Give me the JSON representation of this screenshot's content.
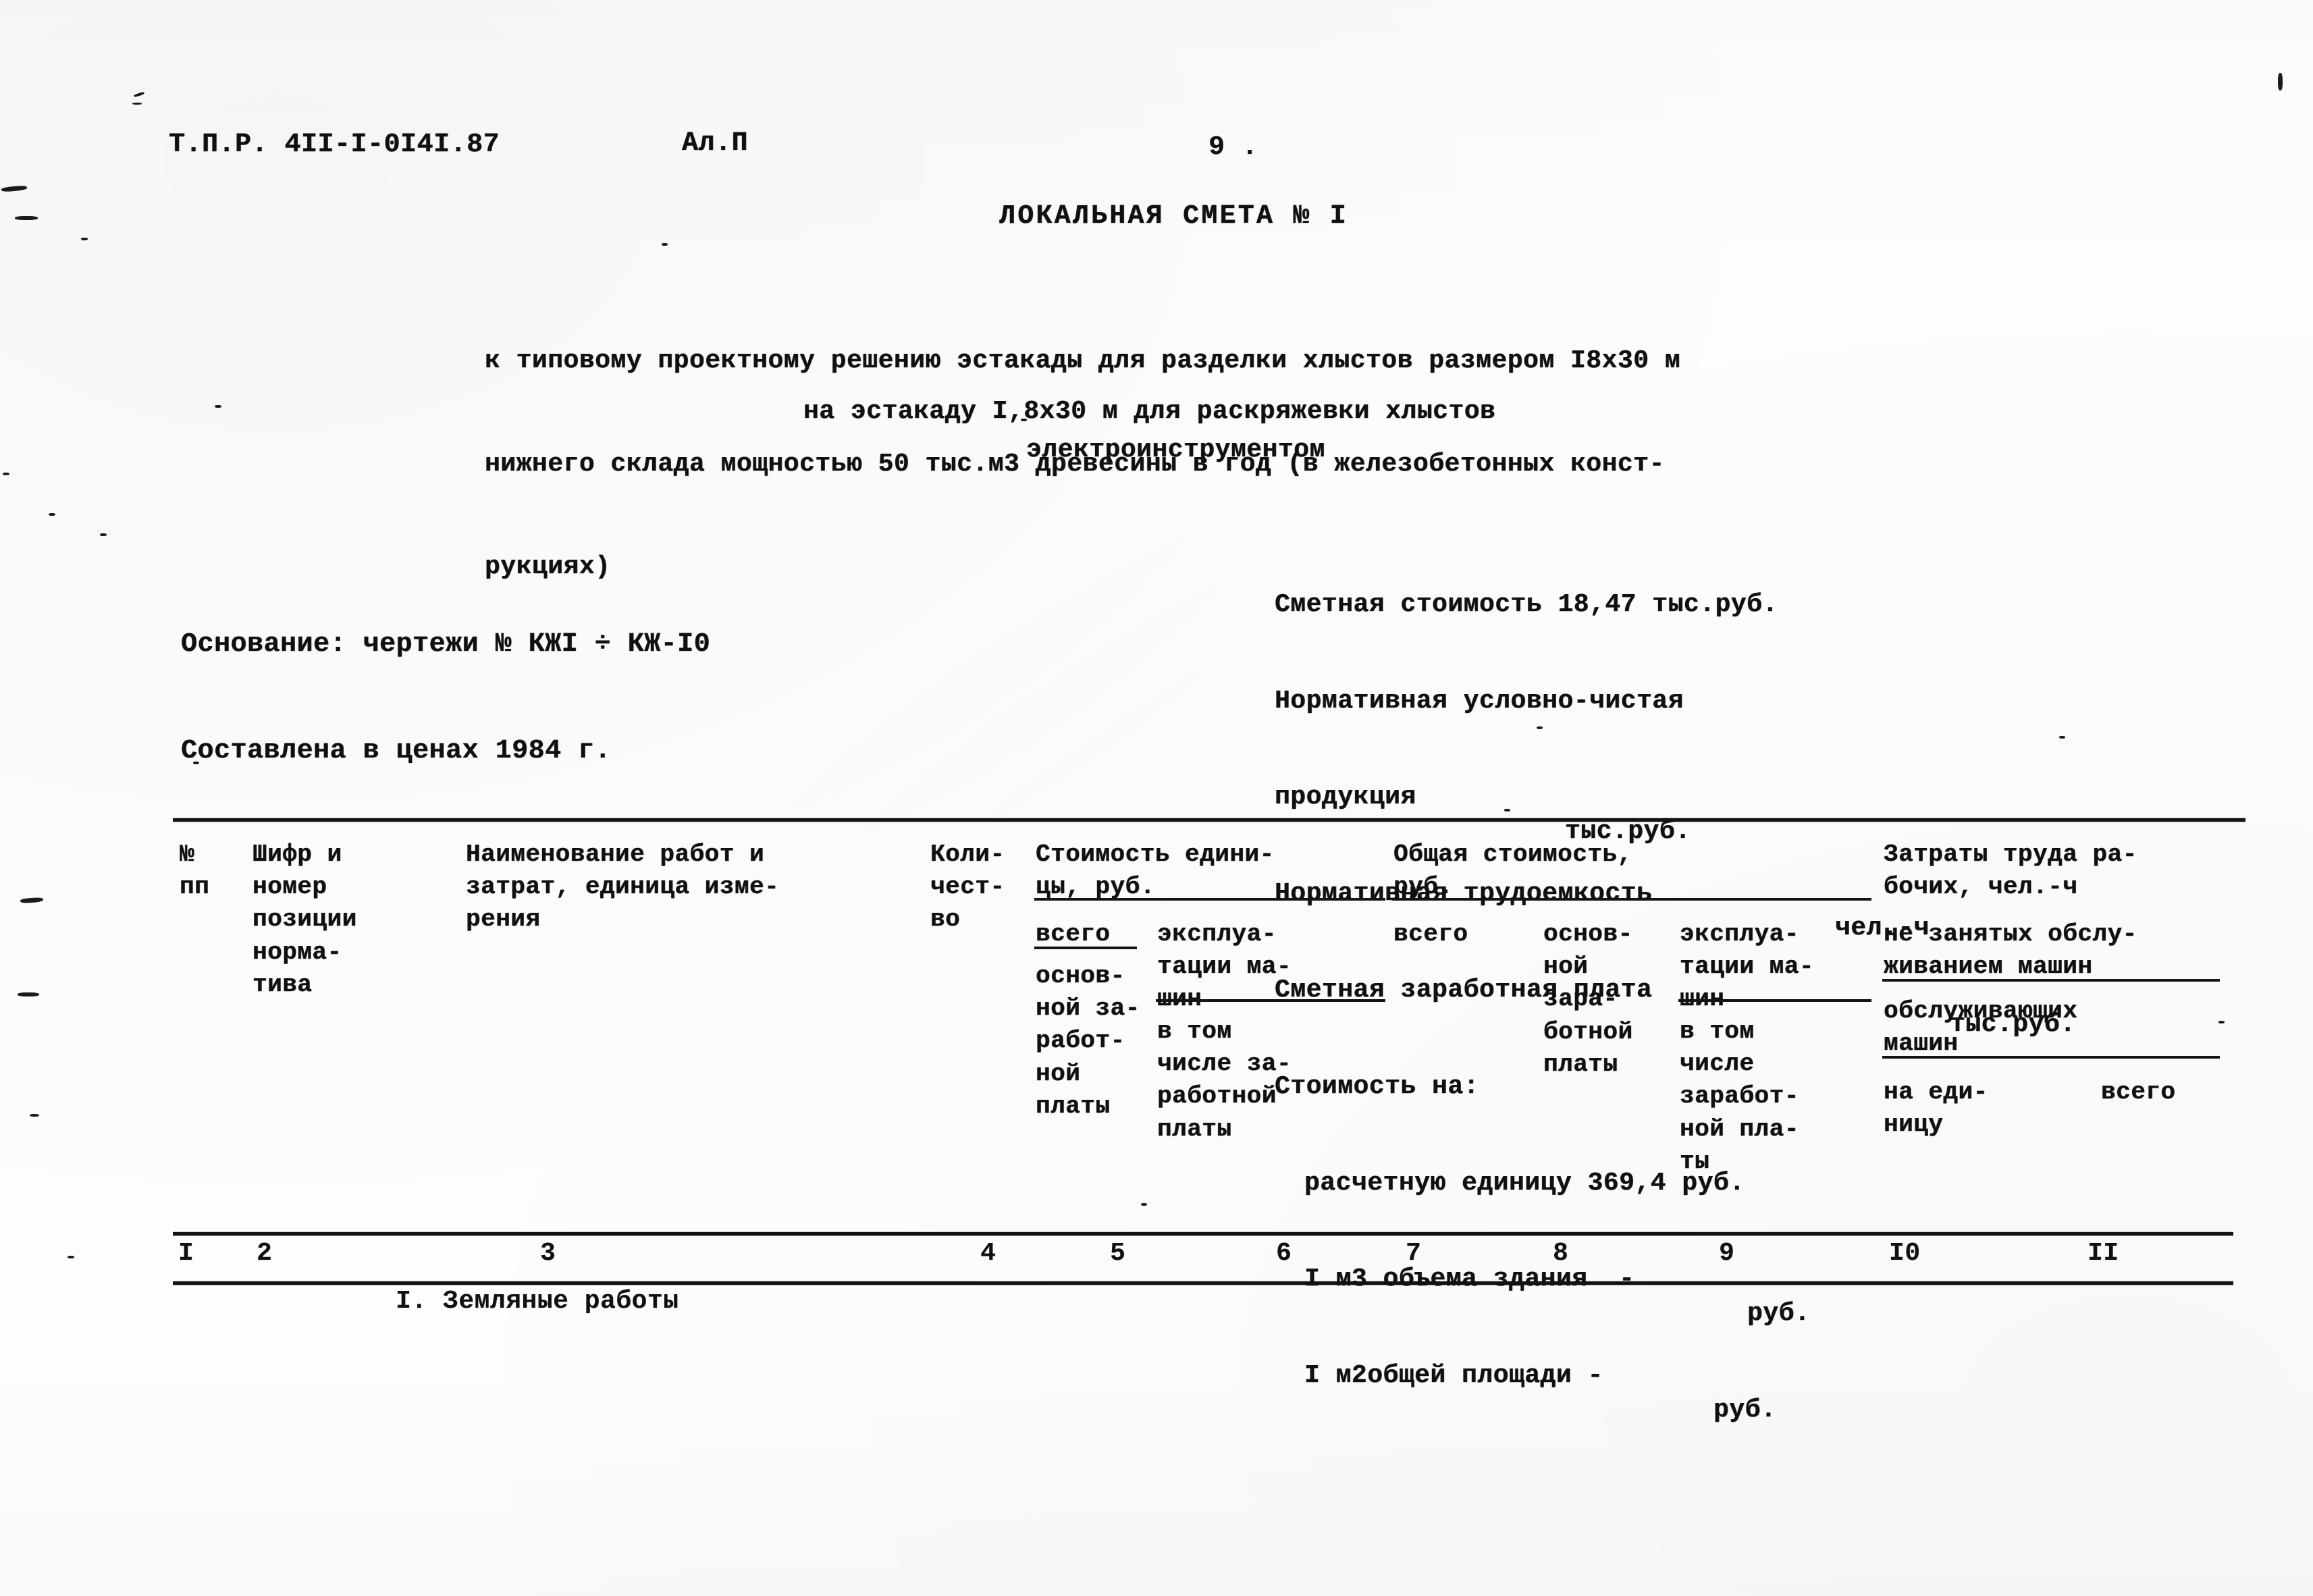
{
  "header": {
    "doc_code": "Т.П.Р. 4II-I-0I4I.87",
    "album": "Ал.П",
    "page_number": "9 ."
  },
  "title": "ЛОКАЛЬНАЯ СМЕТА № I",
  "intro": {
    "line1": "к типовому проектному решению эстакады для разделки хлыстов размером I8x30 м",
    "line2": "нижнего склада мощностью 50 тыс.м3 древесины в год (в железобетонных конст-",
    "line3": "рукциях)"
  },
  "subtitle": {
    "line1": "на эстакаду I,8x30 м для раскряжевки хлыстов",
    "line2": "электроинструментом"
  },
  "basis": "Основание: чертежи № КЖI ÷ КЖ-I0",
  "prices": "Составлена в ценах 1984 г.",
  "summary": [
    {
      "label": "Сметная стоимость 18,47 тыс.руб.",
      "value": ""
    },
    {
      "label": "Нормативная условно-чистая",
      "value": ""
    },
    {
      "label": "продукция",
      "value": "тыс.руб."
    },
    {
      "label": "Нормативная трудоемкость",
      "value": "чел.-ч"
    },
    {
      "label": "Сметная заработная плата",
      "value": "тыс.руб."
    },
    {
      "label": "Стоимость на:",
      "value": ""
    },
    {
      "label": "расчетную единицу 369,4 руб.",
      "value": ""
    },
    {
      "label": "I м3 объема здания  -",
      "value": "руб."
    },
    {
      "label": "I м2общей площади -",
      "value": "руб."
    }
  ],
  "table": {
    "headers": {
      "col1": "№\nпп",
      "col2": "Шифр и\nномер\nпозиции\nнорма-\nтива",
      "col3": "Наименование работ и\nзатрат, единица изме-\nрения",
      "col4": "Коли-\nчест-\nво",
      "col5_group": "Стоимость едини-\nцы, руб.",
      "col5_sub_a": "всего",
      "col5_sub_b": "основ-\nной за-\nработ-\nной\nплаты",
      "col6_sub_a": "эксплуа-\nтации ма-\nшин",
      "col6_sub_b": "в том\nчисле за-\nработной\nплаты",
      "col7_group": "Общая стоимость,\nруб.",
      "col7_sub": "всего",
      "col8_sub": "основ-\nной\nзара-\nботной\nплаты",
      "col9_sub_a": "эксплуа-\nтации ма-\nшин",
      "col9_sub_b": "в том\nчисле\nзаработ-\nной пла-\nты",
      "col10_group": "Затраты труда ра-\nбочих, чел.-ч",
      "col10_sub_a": "не занятых обслу-\nживанием машин",
      "col10_sub_b": "обслуживающих\nмашин",
      "col10_sub_c": "на еди-\nницу",
      "col11_sub": "всего"
    },
    "column_numbers": [
      "I",
      "2",
      "3",
      "4",
      "5",
      "6",
      "7",
      "8",
      "9",
      "I0",
      "II"
    ]
  },
  "sections": [
    {
      "caption": "I. Земляные работы"
    }
  ]
}
